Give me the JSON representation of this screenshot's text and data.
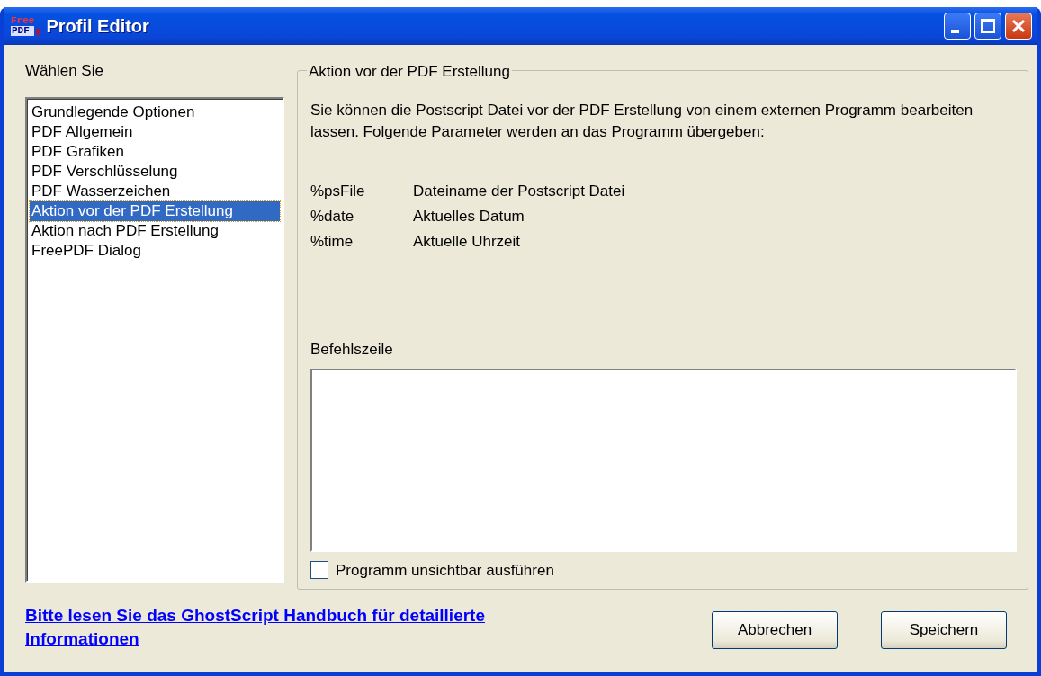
{
  "window": {
    "title": "Profil Editor",
    "logo": [
      "Free",
      "PDF",
      "3"
    ]
  },
  "sidebar": {
    "label": "Wählen Sie",
    "items": [
      {
        "label": "Grundlegende Optionen",
        "selected": false
      },
      {
        "label": "PDF Allgemein",
        "selected": false
      },
      {
        "label": "PDF Grafiken",
        "selected": false
      },
      {
        "label": "PDF Verschlüsselung",
        "selected": false
      },
      {
        "label": "PDF Wasserzeichen",
        "selected": false
      },
      {
        "label": "Aktion vor der PDF Erstellung",
        "selected": true
      },
      {
        "label": "Aktion nach PDF Erstellung",
        "selected": false
      },
      {
        "label": "FreePDF Dialog",
        "selected": false
      }
    ]
  },
  "group": {
    "title": "Aktion vor der PDF Erstellung",
    "description": "Sie können die Postscript Datei vor der PDF Erstellung von einem externen Programm bearbeiten lassen. Folgende Parameter werden an das Programm übergeben:",
    "parameters": [
      {
        "name": "%psFile",
        "meaning": "Dateiname der Postscript Datei"
      },
      {
        "name": "%date",
        "meaning": "Aktuelles Datum"
      },
      {
        "name": "%time",
        "meaning": "Aktuelle Uhrzeit"
      }
    ],
    "command_label": "Befehlszeile",
    "checkbox": {
      "label": "Programm unsichtbar ausführen",
      "checked": false
    }
  },
  "help_link": "Bitte lesen Sie das GhostScript Handbuch für detaillierte Informationen",
  "buttons": [
    {
      "label": "Abbrechen",
      "access_key_underlined": true
    },
    {
      "label": "Speichern",
      "access_key_underlined": true
    }
  ]
}
